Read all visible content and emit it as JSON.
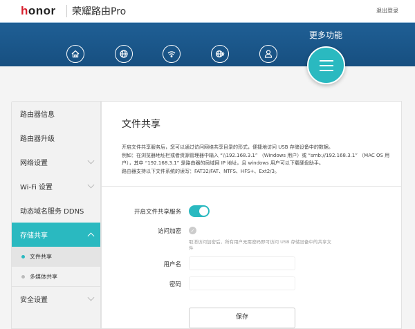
{
  "header": {
    "brand": "honor",
    "brand_prefix": "荣耀",
    "app_title": "荣耀路由Pro",
    "logout": "退出登录"
  },
  "nav": {
    "items": [
      {
        "icon": "home-icon"
      },
      {
        "icon": "globe-icon"
      },
      {
        "icon": "wifi-icon"
      },
      {
        "icon": "globe-speed-icon"
      },
      {
        "icon": "user-icon"
      }
    ],
    "more_label": "更多功能"
  },
  "sidebar": {
    "items": [
      {
        "label": "路由器信息"
      },
      {
        "label": "路由器升级"
      },
      {
        "label": "网络设置"
      },
      {
        "label": "Wi-Fi 设置"
      },
      {
        "label": "动态域名服务 DDNS"
      },
      {
        "label": "存储共享"
      },
      {
        "label": "安全设置"
      }
    ],
    "sub_items": [
      {
        "label": "文件共享"
      },
      {
        "label": "多媒体共享"
      }
    ]
  },
  "main": {
    "title": "文件共享",
    "desc": [
      "开启文件共享服务后，您可以通过访问网络共享目录的形式，便捷地访问 USB 存储设备中的数据。",
      "例如：在浏览器地址栏或者资源管理器中输入 “\\\\192.168.3.1” （Windows 用户）或 “smb://192.168.3.1” （MAC OS 用户），其中 “192.168.3.1” 是路由器的局域网 IP 地址，且 windows 用户可以下载硬盘助手。",
      "路由器支持以下文件系统的读写：FAT32/FAT、NTFS、HFS+、Ext2/3。"
    ],
    "enable_label": "开启文件共享服务",
    "enable_on": true,
    "encrypt_label": "访问加密",
    "encrypt_hint": "取消访问加密后，所有用户无需密码即可访问 USB 存储设备中的共享文件",
    "username_label": "用户名",
    "username_value": "",
    "password_label": "密码",
    "password_value": "",
    "save": "保存"
  }
}
